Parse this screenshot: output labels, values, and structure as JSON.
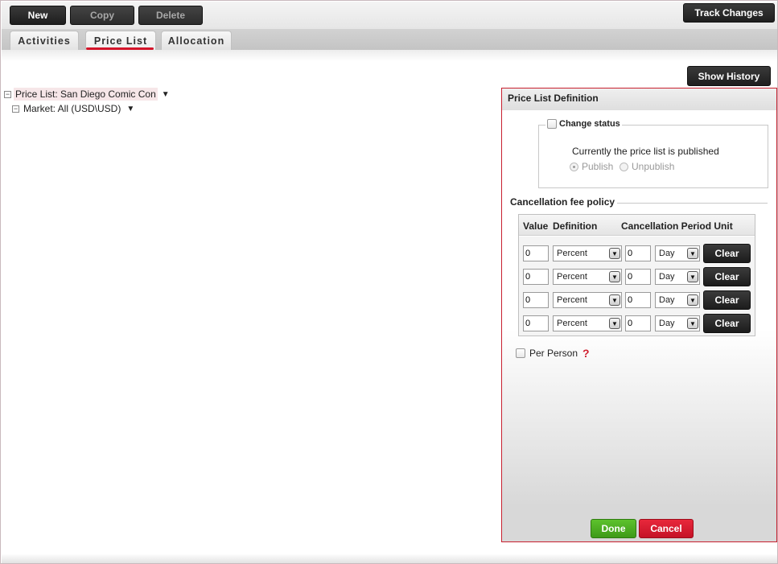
{
  "toolbar": {
    "new_label": "New",
    "copy_label": "Copy",
    "delete_label": "Delete",
    "track_changes_label": "Track Changes"
  },
  "tabs": [
    {
      "label": "Activities",
      "active": false
    },
    {
      "label": "Price List",
      "active": true
    },
    {
      "label": "Allocation",
      "active": false
    }
  ],
  "show_history_label": "Show History",
  "tree": {
    "price_list": "Price List: San Diego Comic Con",
    "market": "Market: All (USD\\USD)"
  },
  "panel": {
    "title": "Price List Definition",
    "change_status": {
      "label": "Change status",
      "checked": false,
      "status_text": "Currently the price list is published",
      "publish_label": "Publish",
      "unpublish_label": "Unpublish",
      "selected": "Publish"
    },
    "cancellation": {
      "title": "Cancellation fee policy",
      "headers": {
        "value": "Value",
        "definition": "Definition",
        "period_unit": "Cancellation Period Unit"
      },
      "rows": [
        {
          "value": "0",
          "definition": "Percent",
          "period": "0",
          "unit": "Day",
          "clear": "Clear"
        },
        {
          "value": "0",
          "definition": "Percent",
          "period": "0",
          "unit": "Day",
          "clear": "Clear"
        },
        {
          "value": "0",
          "definition": "Percent",
          "period": "0",
          "unit": "Day",
          "clear": "Clear"
        },
        {
          "value": "0",
          "definition": "Percent",
          "period": "0",
          "unit": "Day",
          "clear": "Clear"
        }
      ]
    },
    "per_person_label": "Per Person",
    "done_label": "Done",
    "cancel_label": "Cancel"
  },
  "colors": {
    "accent_red": "#d4142a",
    "done_green": "#4aab20",
    "cancel_red": "#d51c30",
    "dark_button": "#262626"
  },
  "icons": {
    "tree_toggle": "minus-box-icon",
    "dropdown_caret": "caret-down-icon",
    "select_arrow": "chevron-down-icon",
    "help": "question-mark-icon"
  }
}
